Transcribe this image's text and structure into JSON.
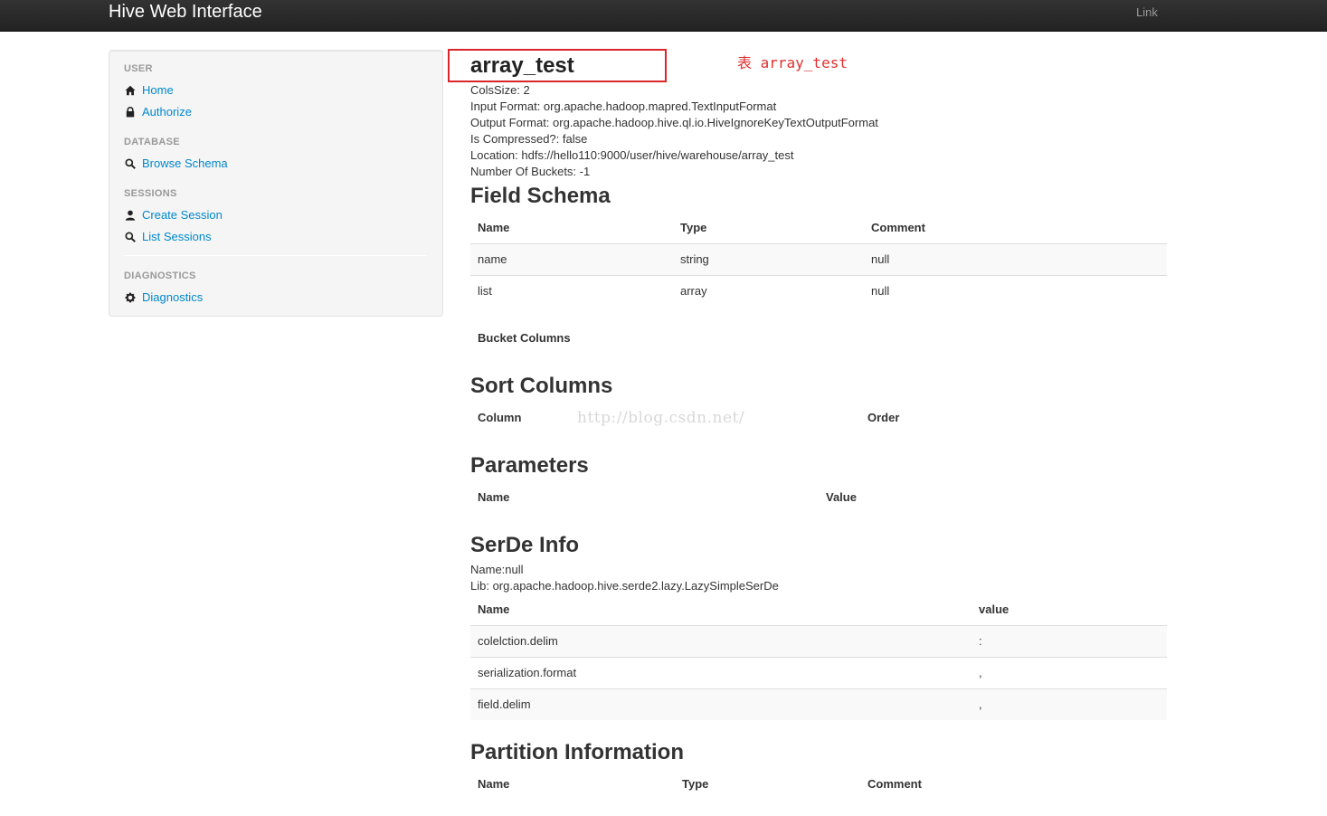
{
  "navbar": {
    "brand": "Hive Web Interface",
    "link": "Link"
  },
  "sidebar": {
    "sections": [
      {
        "header": "USER",
        "items": [
          {
            "label": "Home",
            "icon": "home-icon"
          },
          {
            "label": "Authorize",
            "icon": "lock-icon"
          }
        ]
      },
      {
        "header": "DATABASE",
        "items": [
          {
            "label": "Browse Schema",
            "icon": "search-icon"
          }
        ]
      },
      {
        "header": "SESSIONS",
        "items": [
          {
            "label": "Create Session",
            "icon": "user-icon"
          },
          {
            "label": "List Sessions",
            "icon": "search-icon"
          }
        ]
      },
      {
        "header": "DIAGNOSTICS",
        "items": [
          {
            "label": "Diagnostics",
            "icon": "gear-icon"
          }
        ]
      }
    ]
  },
  "table_info": {
    "title": "array_test",
    "annotation": "表 array_test",
    "lines": [
      "ColsSize: 2",
      "Input Format: org.apache.hadoop.mapred.TextInputFormat",
      "Output Format: org.apache.hadoop.hive.ql.io.HiveIgnoreKeyTextOutputFormat",
      "Is Compressed?: false",
      "Location: hdfs://hello110:9000/user/hive/warehouse/array_test",
      "Number Of Buckets: -1"
    ]
  },
  "field_schema": {
    "title": "Field Schema",
    "headers": [
      "Name",
      "Type",
      "Comment"
    ],
    "rows": [
      [
        "name",
        "string",
        "null"
      ],
      [
        "list",
        "array",
        "null"
      ]
    ]
  },
  "bucket_columns": {
    "header": "Bucket Columns"
  },
  "sort_columns": {
    "title": "Sort Columns",
    "headers": [
      "Column",
      "Order"
    ]
  },
  "parameters": {
    "title": "Parameters",
    "headers": [
      "Name",
      "Value"
    ]
  },
  "serde_info": {
    "title": "SerDe Info",
    "name_line": "Name:null",
    "lib_line": "Lib: org.apache.hadoop.hive.serde2.lazy.LazySimpleSerDe",
    "headers": [
      "Name",
      "value"
    ],
    "rows": [
      [
        "colelction.delim",
        ":"
      ],
      [
        "serialization.format",
        ","
      ],
      [
        "field.delim",
        ","
      ]
    ]
  },
  "partition_info": {
    "title": "Partition Information",
    "headers": [
      "Name",
      "Type",
      "Comment"
    ]
  },
  "watermark": "http://blog.csdn.net/",
  "colors": {
    "navbar": "#222222",
    "link": "#0088cc",
    "highlight": "#d9262b"
  }
}
